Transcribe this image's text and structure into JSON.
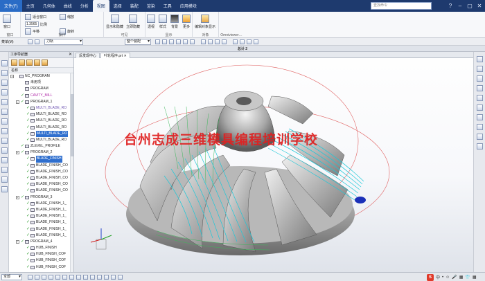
{
  "menu": {
    "file": "文件(F)",
    "items": [
      "主页",
      "几何体",
      "曲线",
      "分析",
      "视图",
      "选择",
      "装配",
      "渲染",
      "工具",
      "应用模块"
    ],
    "active_index": 4,
    "search_placeholder": "查找命令"
  },
  "ribbon": {
    "window_label": "窗口",
    "combine_window": "适合窗口",
    "zoom_label": "缩放",
    "zoom_value": "1.3565",
    "scale_label": "比例",
    "pan": "平移",
    "rotate": "旋转",
    "show_hide": "显示和隐藏",
    "immediate_hide": "立即隐藏",
    "perspective": "透视",
    "style": "样式",
    "background": "背景",
    "more": "更多",
    "edit_object_display": "编辑对象显示",
    "groups": {
      "window": "窗口",
      "operation": "操作",
      "visibility": "可见",
      "display": "显示",
      "object": "对象",
      "omniviewer": "Omniviewer…"
    }
  },
  "selection": {
    "menu_label": "菜单(M)",
    "filter": "刀轨",
    "scope": "整个装配"
  },
  "view_title": "总计 2",
  "navigator": {
    "title": "工序导航器",
    "column": "名称",
    "items": [
      {
        "label": "NC_PROGRAM",
        "indent": 0,
        "style": "normal",
        "exp": "-"
      },
      {
        "label": "未用项",
        "indent": 1,
        "style": "normal"
      },
      {
        "label": "PROGRAM",
        "indent": 1,
        "style": "normal"
      },
      {
        "label": "CAVITY_MILL",
        "indent": 1,
        "style": "magenta",
        "check": true
      },
      {
        "label": "PROGRAM_1",
        "indent": 1,
        "style": "normal",
        "check": true,
        "exp": "-"
      },
      {
        "label": "MULTI_BLADE_RO",
        "indent": 2,
        "style": "violet",
        "check": true
      },
      {
        "label": "MULTI_BLADE_RO",
        "indent": 2,
        "style": "normal",
        "check": true
      },
      {
        "label": "MULTI_BLADE_RO",
        "indent": 2,
        "style": "normal",
        "check": true
      },
      {
        "label": "MULTI_BLADE_RO",
        "indent": 2,
        "style": "normal",
        "check": true
      },
      {
        "label": "MULTI_BLADE_RO",
        "indent": 2,
        "style": "selected",
        "check": true
      },
      {
        "label": "MULTI_BLADE_RO",
        "indent": 2,
        "style": "normal",
        "check": true
      },
      {
        "label": "ZLEVEL_PROFILE",
        "indent": 1,
        "style": "normal",
        "check": true
      },
      {
        "label": "PROGRAM_2",
        "indent": 1,
        "style": "normal",
        "check": true,
        "exp": "-"
      },
      {
        "label": "BLADE_FINISH",
        "indent": 2,
        "style": "selected",
        "check": true
      },
      {
        "label": "BLADE_FINISH_CO",
        "indent": 2,
        "style": "normal",
        "check": true
      },
      {
        "label": "BLADE_FINISH_CO",
        "indent": 2,
        "style": "normal",
        "check": true
      },
      {
        "label": "BLADE_FINISH_CO",
        "indent": 2,
        "style": "normal",
        "check": true
      },
      {
        "label": "BLADE_FINISH_CO",
        "indent": 2,
        "style": "normal",
        "check": true
      },
      {
        "label": "BLADE_FINISH_CO",
        "indent": 2,
        "style": "normal",
        "check": true
      },
      {
        "label": "PROGRAM_3",
        "indent": 1,
        "style": "normal",
        "check": true,
        "exp": "-"
      },
      {
        "label": "BLADE_FINISH_1_",
        "indent": 2,
        "style": "normal",
        "check": true
      },
      {
        "label": "BLADE_FINISH_1_",
        "indent": 2,
        "style": "normal",
        "check": true
      },
      {
        "label": "BLADE_FINISH_1_",
        "indent": 2,
        "style": "normal",
        "check": true
      },
      {
        "label": "BLADE_FINISH_1_",
        "indent": 2,
        "style": "normal",
        "check": true
      },
      {
        "label": "BLADE_FINISH_1_",
        "indent": 2,
        "style": "normal",
        "check": true
      },
      {
        "label": "BLADE_FINISH_1_",
        "indent": 2,
        "style": "normal",
        "check": true
      },
      {
        "label": "PROGRAM_4",
        "indent": 1,
        "style": "normal",
        "check": true,
        "exp": "-"
      },
      {
        "label": "HUB_FINISH",
        "indent": 2,
        "style": "normal",
        "check": true
      },
      {
        "label": "HUB_FINISH_COF",
        "indent": 2,
        "style": "normal",
        "check": true
      },
      {
        "label": "HUB_FINISH_COF",
        "indent": 2,
        "style": "normal",
        "check": true
      },
      {
        "label": "HUB_FINISH_COF",
        "indent": 2,
        "style": "normal",
        "check": true
      }
    ]
  },
  "tabs": [
    {
      "label": "反发现中心"
    },
    {
      "label": "叶轮程序.prt ✕",
      "active": true
    }
  ],
  "watermark": "台州志成三维模具编程培训学校",
  "status": {
    "filter": "全部",
    "ime_s": "S",
    "ime_lang": "中",
    "ime_items": [
      "•",
      "☺",
      "🎤",
      "▦",
      "👕",
      "▦"
    ]
  },
  "colors": {
    "titlebar": "#1e3a6e",
    "file_tab": "#2a6cc6",
    "selection": "#2f6fce",
    "toolpath": "#1ec8d8",
    "watermark": "#e02020"
  }
}
